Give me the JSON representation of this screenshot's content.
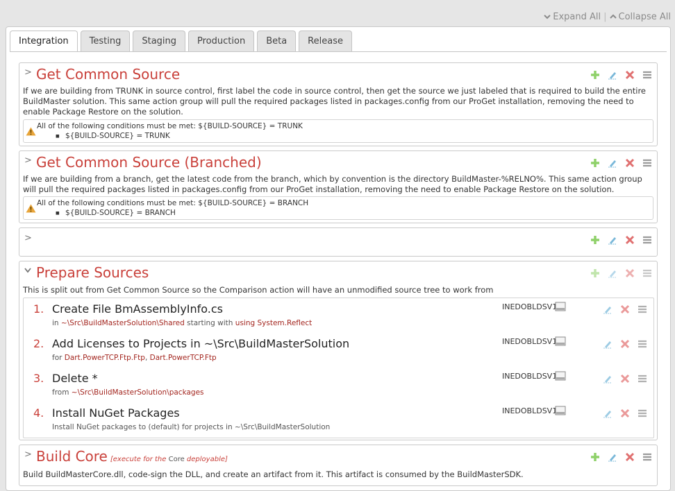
{
  "topbar": {
    "expand_all": "Expand All",
    "collapse_all": "Collapse All"
  },
  "tabs": [
    "Integration",
    "Testing",
    "Staging",
    "Production",
    "Beta",
    "Release"
  ],
  "groups": [
    {
      "title": "Get Common Source",
      "description": "If we are building from TRUNK in source control, first label the code in source control, then get the source we just labeled that is required to build the entire BuildMaster solution. This same action group will pull the required packages listed in packages.config from our ProGet installation, removing the need to enable Package Restore on the solution.",
      "condition_line1": "All of the following conditions must be met: ${BUILD-SOURCE} = TRUNK",
      "condition_line2": "${BUILD-SOURCE} = TRUNK"
    },
    {
      "title": "Get Common Source (Branched)",
      "description": "If we are building from a branch, get the latest code from the branch, which by convention is the directory BuildMaster-%RELNO%. This same action group will pull the required packages listed in packages.config from our ProGet installation, removing the need to enable Package Restore on the solution.",
      "condition_line1": "All of the following conditions must be met: ${BUILD-SOURCE} = BRANCH",
      "condition_line2": "${BUILD-SOURCE} = BRANCH"
    },
    {
      "title": "Prepare Sources",
      "description": "This is split out from Get Common Source so the Comparison action will have an unmodified source tree to work from",
      "actions": [
        {
          "num": "1.",
          "name": "Create File BmAssemblyInfo.cs",
          "pre": "in ",
          "v1": "~\\Src\\BuildMasterSolution\\Shared",
          "mid": " starting with ",
          "v2": "using System.Reflect",
          "server": "INEDOBLDSV1"
        },
        {
          "num": "2.",
          "name": "Add Licenses to Projects in ~\\Src\\BuildMasterSolution",
          "pre": "for ",
          "v1": "Dart.PowerTCP.Ftp.Ftp",
          "mid": ", ",
          "v2": "Dart.PowerTCP.Ftp",
          "server": "INEDOBLDSV1"
        },
        {
          "num": "3.",
          "name": "Delete *",
          "pre": "from ",
          "v1": "~\\Src\\BuildMasterSolution\\packages",
          "mid": "",
          "v2": "",
          "server": "INEDOBLDSV1"
        },
        {
          "num": "4.",
          "name": "Install NuGet Packages",
          "pre": "Install NuGet packages to (default) for projects in ~\\Src\\BuildMasterSolution",
          "v1": "",
          "mid": "",
          "v2": "",
          "server": "INEDOBLDSV1"
        }
      ]
    },
    {
      "title": "Build Core",
      "note_pre": "[execute for the ",
      "note_core": "Core",
      "note_post": " deployable]",
      "description": "Build BuildMasterCore.dll, code-sign the DLL, and create an artifact from it. This artifact is consumed by the BuildMasterSDK."
    }
  ],
  "colors": {
    "title": "#c9403a",
    "add": "#8fd16a",
    "edit": "#7ab8d9",
    "delete": "#e07070",
    "menu": "#9a9a9a"
  },
  "icons": [
    "chevron-right-icon",
    "chevron-down-icon",
    "plus-icon",
    "pencil-icon",
    "delete-x-icon",
    "hamburger-icon",
    "warning-icon",
    "drive-icon"
  ]
}
